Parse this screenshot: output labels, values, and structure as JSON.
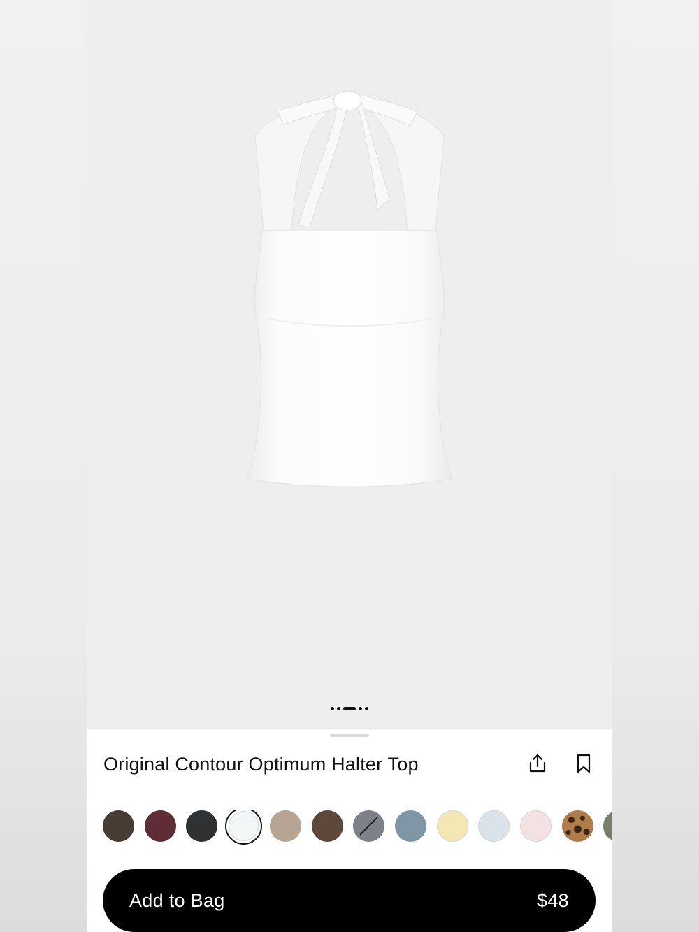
{
  "product": {
    "name": "Original Contour Optimum Halter Top",
    "image_icon": "white-halter-top-image",
    "gallery_pages": 5,
    "gallery_active_index": 2
  },
  "actions": {
    "share_icon": "share-icon",
    "save_icon": "bookmark-icon"
  },
  "swatches": [
    {
      "name": "swatch-dark-brown",
      "color": "#463c34"
    },
    {
      "name": "swatch-burgundy",
      "color": "#5e2d35"
    },
    {
      "name": "swatch-charcoal",
      "color": "#303132"
    },
    {
      "name": "swatch-white",
      "color": "#f3f6f6",
      "selected": true
    },
    {
      "name": "swatch-taupe",
      "color": "#b6a593"
    },
    {
      "name": "swatch-cocoa",
      "color": "#5e483b"
    },
    {
      "name": "swatch-gray-sold-out",
      "color": "#7e8187",
      "sold_out": true
    },
    {
      "name": "swatch-slate-blue",
      "color": "#7f96a7"
    },
    {
      "name": "swatch-butter",
      "color": "#f5e7b4"
    },
    {
      "name": "swatch-light-blue",
      "color": "#dae3ea"
    },
    {
      "name": "swatch-pale-pink",
      "color": "#f4e1e3"
    },
    {
      "name": "swatch-leopard",
      "color": "#9a6a3c",
      "pattern": "leopard"
    },
    {
      "name": "swatch-olive",
      "color": "#78806a"
    }
  ],
  "cart": {
    "add_label": "Add to Bag",
    "price": "$48"
  }
}
